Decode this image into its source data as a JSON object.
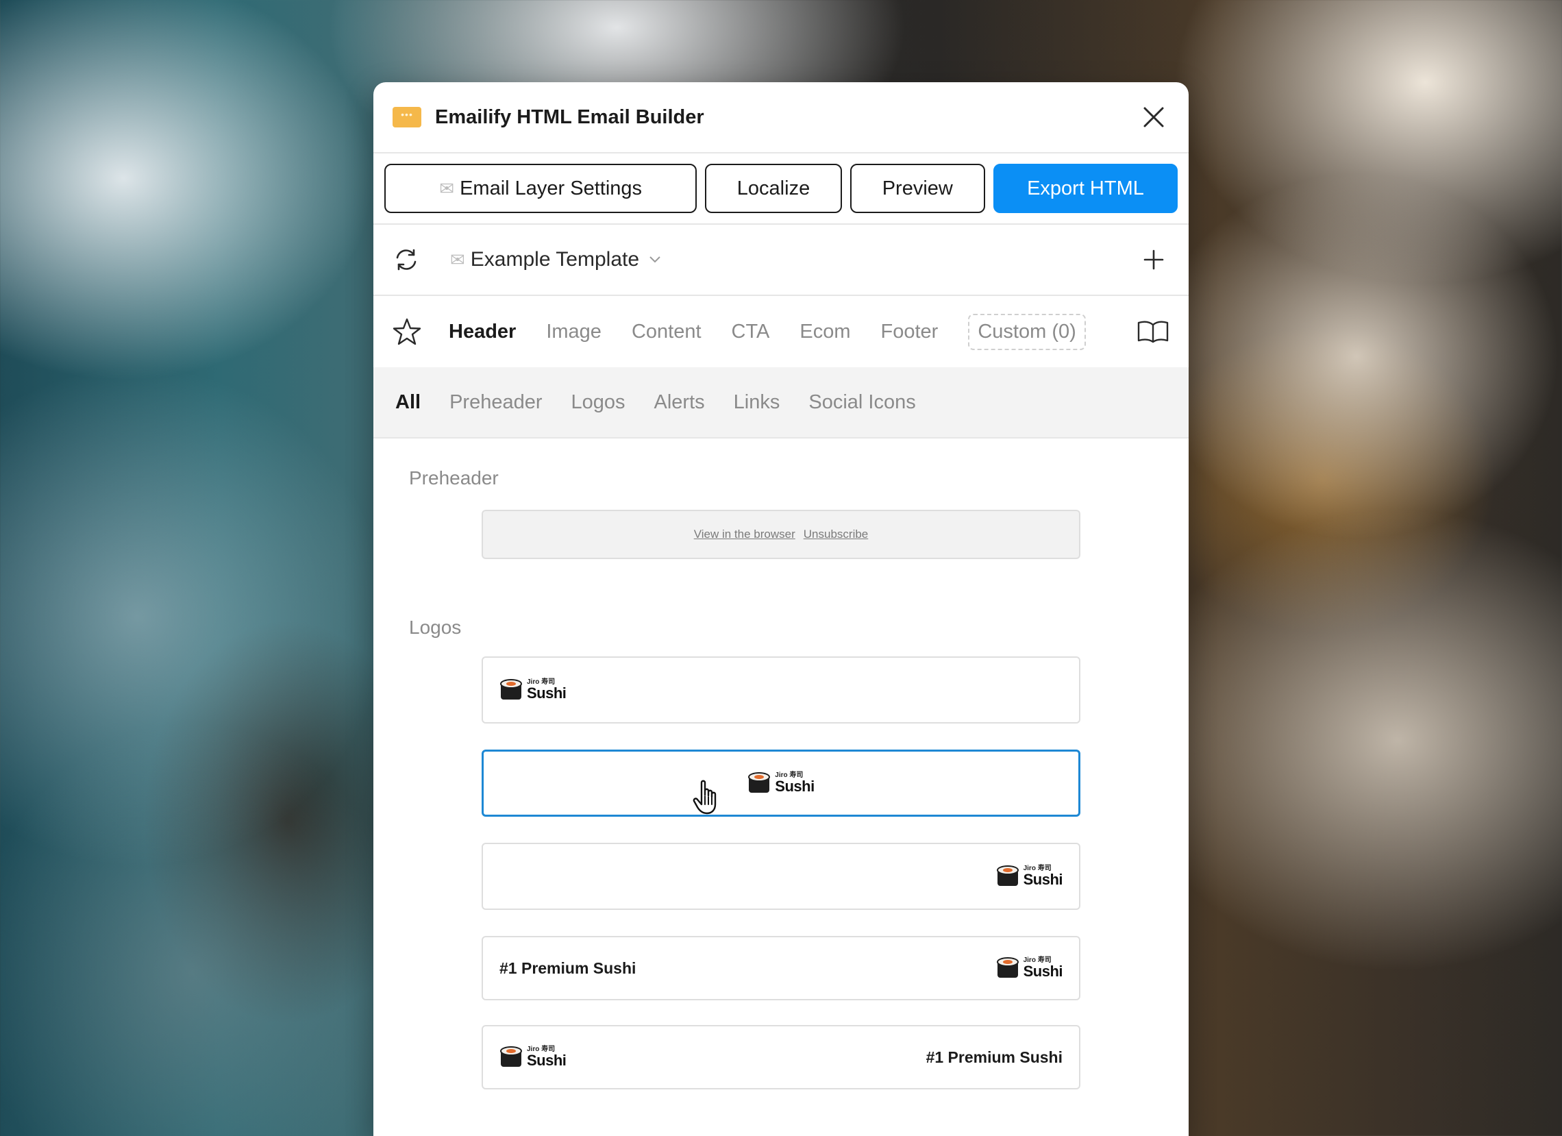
{
  "window": {
    "title": "Emailify HTML Email Builder"
  },
  "toolbar": {
    "email_layer_settings": "Email Layer Settings",
    "localize": "Localize",
    "preview": "Preview",
    "export_html": "Export HTML",
    "export_color": "#0b8ff5"
  },
  "template": {
    "selected": "Example Template"
  },
  "tabs": [
    {
      "label": "Header",
      "active": true
    },
    {
      "label": "Image"
    },
    {
      "label": "Content"
    },
    {
      "label": "CTA"
    },
    {
      "label": "Ecom"
    },
    {
      "label": "Footer"
    },
    {
      "label": "Custom (0)"
    }
  ],
  "subtabs": [
    {
      "label": "All",
      "active": true
    },
    {
      "label": "Preheader"
    },
    {
      "label": "Logos"
    },
    {
      "label": "Alerts"
    },
    {
      "label": "Links"
    },
    {
      "label": "Social Icons"
    }
  ],
  "sections": {
    "preheader": {
      "label": "Preheader",
      "view_in_browser": "View in the browser",
      "unsubscribe": "Unsubscribe"
    },
    "logos": {
      "label": "Logos",
      "logo_small": "Jiro 寿司",
      "logo_big": "Sushi",
      "tagline": "#1 Premium Sushi",
      "selected_color": "#1e88d4"
    }
  }
}
